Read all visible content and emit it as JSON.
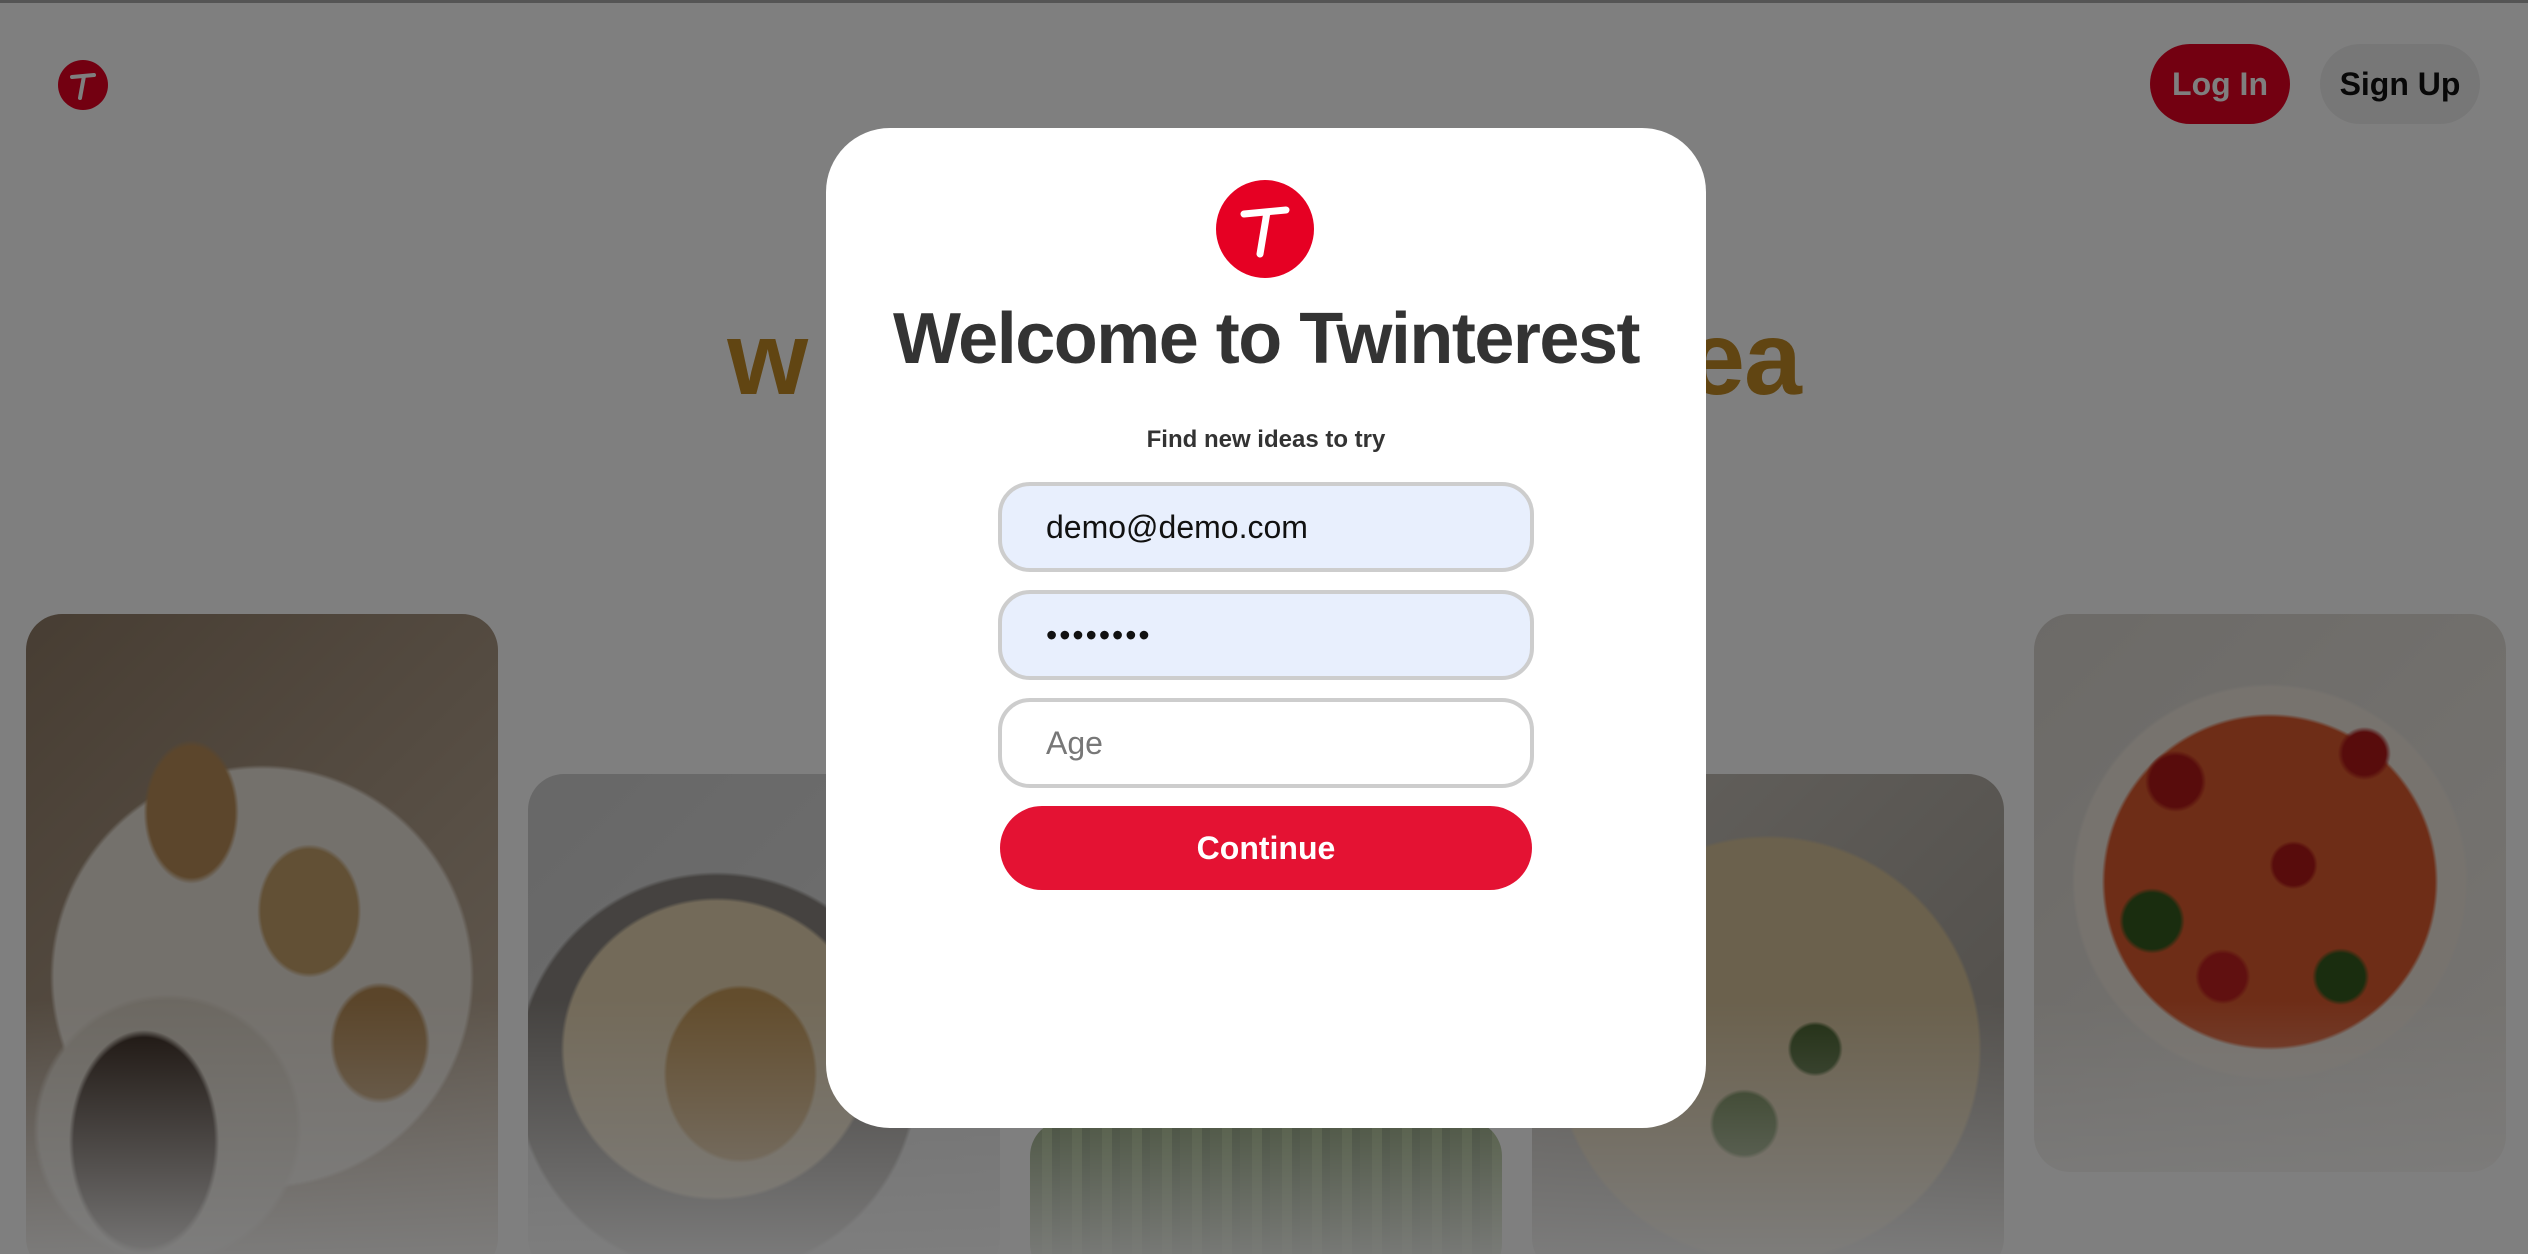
{
  "colors": {
    "brand": "#e60023",
    "continue_button": "#e41233",
    "hero_text": "#c28a24",
    "autofill_background": "#e8effd"
  },
  "header": {
    "logo_icon": "t-logo-icon",
    "login_label": "Log In",
    "signup_label": "Sign Up"
  },
  "hero": {
    "headline_left": "w",
    "headline_right": "ea"
  },
  "modal": {
    "logo_icon": "t-logo-icon",
    "title": "Welcome to Twinterest",
    "subtitle": "Find new ideas to try",
    "email_value": "demo@demo.com",
    "password_value": "••••••••",
    "age_placeholder": "Age",
    "continue_label": "Continue"
  }
}
